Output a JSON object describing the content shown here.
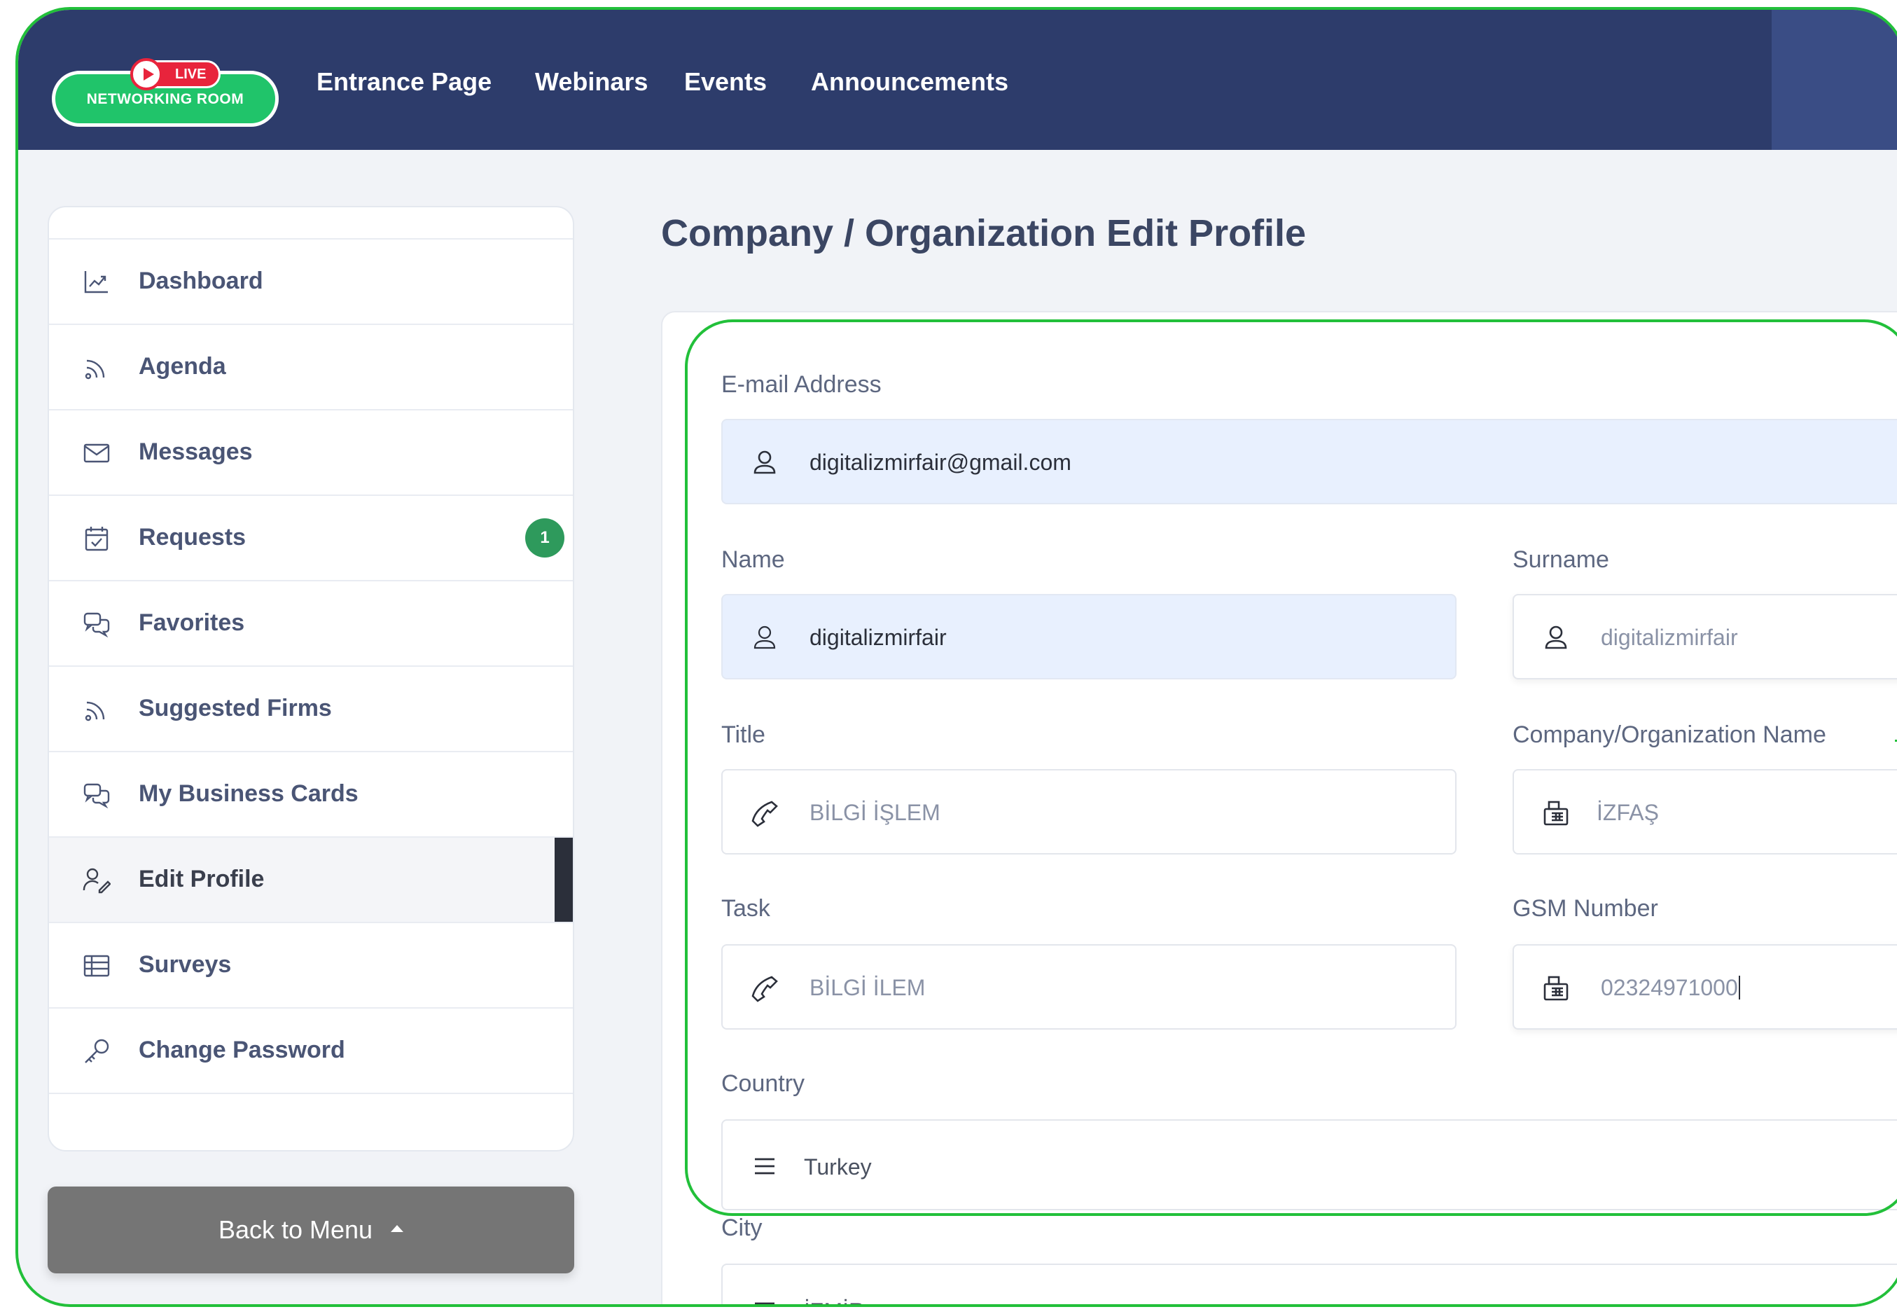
{
  "logo": {
    "live_badge": "LIVE",
    "text": "NETWORKING ROOM"
  },
  "nav": {
    "entrance": "Entrance Page",
    "webinars": "Webinars",
    "events": "Events",
    "announcements": "Announcements"
  },
  "sidebar": {
    "items": [
      {
        "label": "Dashboard",
        "icon": "chart-icon"
      },
      {
        "label": "Agenda",
        "icon": "rss-icon"
      },
      {
        "label": "Messages",
        "icon": "envelope-icon"
      },
      {
        "label": "Requests",
        "icon": "calendar-check-icon",
        "badge": "1"
      },
      {
        "label": "Favorites",
        "icon": "chat-bubbles-icon"
      },
      {
        "label": "Suggested Firms",
        "icon": "rss-icon"
      },
      {
        "label": "My Business Cards",
        "icon": "chat-bubbles-icon"
      },
      {
        "label": "Edit Profile",
        "icon": "user-edit-icon",
        "active": true
      },
      {
        "label": "Surveys",
        "icon": "table-icon"
      },
      {
        "label": "Change Password",
        "icon": "key-icon"
      }
    ],
    "back_button": "Back to Menu"
  },
  "page": {
    "title": "Company / Organization Edit Profile"
  },
  "form": {
    "email": {
      "label": "E-mail Address",
      "value": "digitalizmirfair@gmail.com",
      "icon": "user-icon"
    },
    "name": {
      "label": "Name",
      "value": "digitalizmirfair",
      "icon": "user-icon"
    },
    "surname": {
      "label": "Surname",
      "value": "digitalizmirfair",
      "icon": "user-icon"
    },
    "title": {
      "label": "Title",
      "value": "BİLGİ İŞLEM",
      "icon": "phone-icon"
    },
    "company": {
      "label": "Company/Organization Name",
      "value": "İZFAŞ",
      "icon": "fax-icon"
    },
    "task": {
      "label": "Task",
      "value": "BİLGİ  İLEM",
      "icon": "phone-icon"
    },
    "gsm": {
      "label": "GSM Number",
      "value": "02324971000",
      "icon": "fax-icon"
    },
    "country": {
      "label": "Country",
      "value": "Turkey",
      "icon": "menu-lines-icon"
    },
    "city": {
      "label": "City",
      "value": "İZMİR",
      "icon": "menu-lines-icon"
    }
  },
  "colors": {
    "topbar": "#2d3c6b",
    "highlight": "#22c03a",
    "badge": "#2e9a5c",
    "filled_field": "#e8f0fe",
    "back_button": "#757575"
  }
}
